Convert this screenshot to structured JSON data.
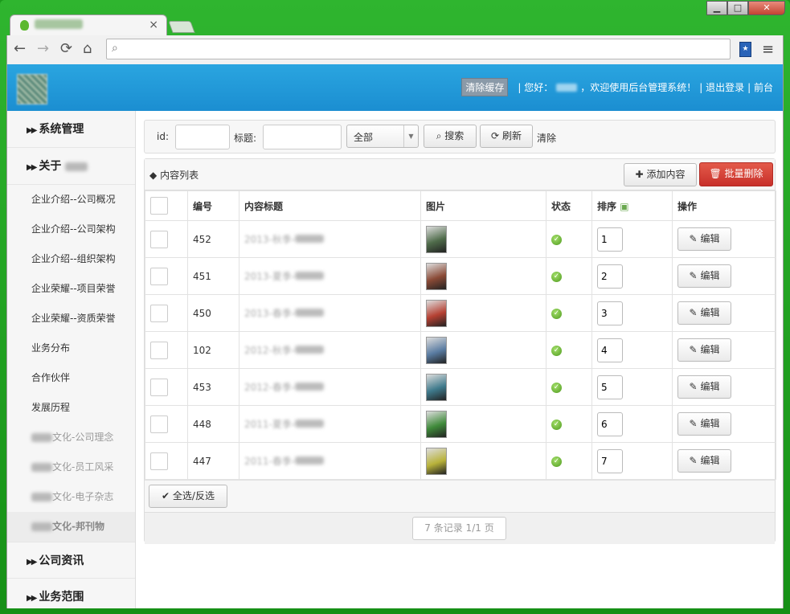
{
  "browser": {
    "tab_close": "×",
    "win_min": "▁",
    "win_max": "□",
    "win_close": "✕",
    "address_value": "",
    "back_icon": "←",
    "forward_icon": "→",
    "reload_icon": "⟳",
    "home_icon": "⌂",
    "menu_icon": "≡"
  },
  "header": {
    "clear_cache": "清除缓存",
    "greeting_pre": "| 您好：",
    "greeting_post": "，欢迎使用后台管理系统！",
    "logout": "| 退出登录",
    "frontend": "| 前台"
  },
  "sidebar": {
    "sections": [
      {
        "label": "系统管理"
      },
      {
        "label": "关于"
      },
      {
        "label": "公司资讯"
      },
      {
        "label": "业务范围"
      }
    ],
    "items": [
      "企业介绍--公司概况",
      "企业介绍--公司架构",
      "企业介绍--组织架构",
      "企业荣耀--项目荣誉",
      "企业荣耀--资质荣誉",
      "业务分布",
      "合作伙伴",
      "发展历程"
    ],
    "culture_items": [
      "文化-公司理念",
      "文化-员工风采",
      "文化-电子杂志",
      "文化-邦刊物"
    ]
  },
  "search": {
    "id_label": "id:",
    "title_label": "标题:",
    "select_value": "全部",
    "search_btn": "搜索",
    "refresh_btn": "刷新",
    "clear_link": "清除"
  },
  "panel": {
    "title": "内容列表",
    "add_btn": "添加内容",
    "bulk_delete_btn": "批量删除",
    "columns": [
      "编号",
      "内容标题",
      "图片",
      "状态",
      "排序",
      "操作"
    ],
    "edit_label": "编辑",
    "rows": [
      {
        "id": "452",
        "title_prefix": "2013-秋季-",
        "sort": "1",
        "thumb": "#4f6b4a"
      },
      {
        "id": "451",
        "title_prefix": "2013-夏季-",
        "sort": "2",
        "thumb": "#8a4a36"
      },
      {
        "id": "450",
        "title_prefix": "2013-春季-",
        "sort": "3",
        "thumb": "#b54032"
      },
      {
        "id": "102",
        "title_prefix": "2012-秋季-",
        "sort": "4",
        "thumb": "#5a7ca2"
      },
      {
        "id": "453",
        "title_prefix": "2012-春季-",
        "sort": "5",
        "thumb": "#3f7a8c"
      },
      {
        "id": "448",
        "title_prefix": "2011-夏季-",
        "sort": "6",
        "thumb": "#3f8a3a"
      },
      {
        "id": "447",
        "title_prefix": "2011-春季-",
        "sort": "7",
        "thumb": "#b8b23a"
      }
    ],
    "select_all_btn": "全选/反选",
    "pager_text": "7 条记录 1/1 页"
  },
  "colors": {
    "header_blue": "#1b8ed1",
    "danger_red": "#c8302a",
    "status_green": "#4f9a1f"
  }
}
